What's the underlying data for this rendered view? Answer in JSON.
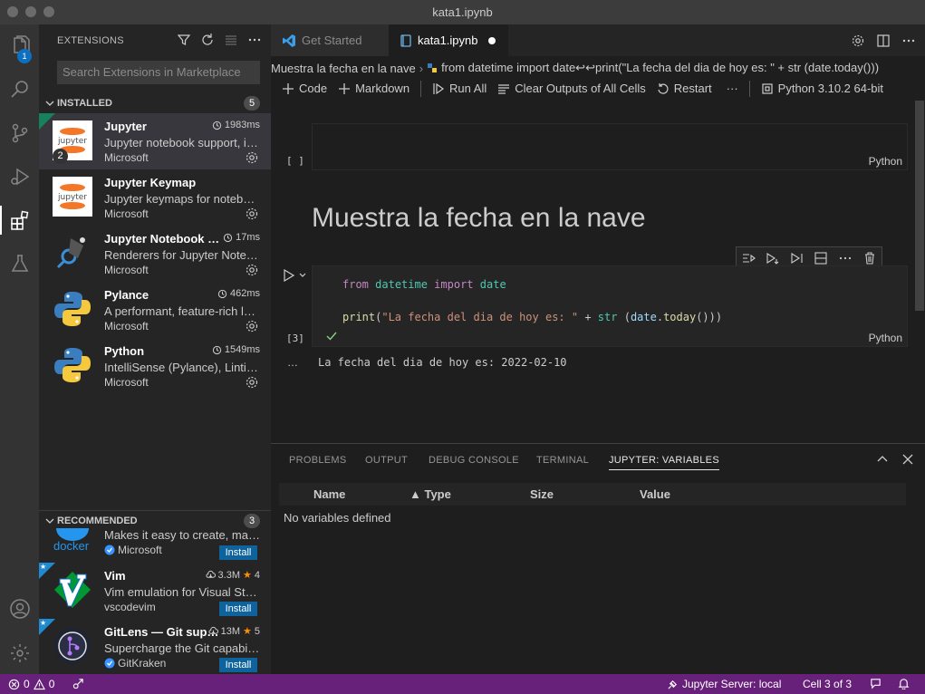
{
  "window": {
    "title": "kata1.ipynb"
  },
  "activity_bar": {
    "extensions_badge": "1"
  },
  "sidebar": {
    "title": "EXTENSIONS",
    "search_placeholder": "Search Extensions in Marketplace",
    "installed": {
      "label": "INSTALLED",
      "count": "5",
      "items": [
        {
          "name": "Jupyter",
          "stat": "1983ms",
          "desc": "Jupyter notebook support, interactive programming and computing",
          "publisher": "Microsoft",
          "badge": "2"
        },
        {
          "name": "Jupyter Keymap",
          "stat": "",
          "desc": "Jupyter keymaps for notebooks",
          "publisher": "Microsoft"
        },
        {
          "name": "Jupyter Notebook Renderers",
          "stat": "17ms",
          "desc": "Renderers for Jupyter Notebooks",
          "publisher": "Microsoft"
        },
        {
          "name": "Pylance",
          "stat": "462ms",
          "desc": "A performant, feature-rich language server",
          "publisher": "Microsoft"
        },
        {
          "name": "Python",
          "stat": "1549ms",
          "desc": "IntelliSense (Pylance), Linting, Debugging",
          "publisher": "Microsoft"
        }
      ]
    },
    "recommended": {
      "label": "RECOMMENDED",
      "count": "3",
      "items": [
        {
          "name": "Docker",
          "desc": "Makes it easy to create, manage, and debug",
          "publisher": "Microsoft",
          "logo_text": "docker",
          "install": "Install"
        },
        {
          "name": "Vim",
          "downloads": "3.3M",
          "rating": "4",
          "desc": "Vim emulation for Visual Studio Code",
          "publisher": "vscodevim",
          "install": "Install"
        },
        {
          "name": "GitLens — Git supercharged",
          "downloads": "13M",
          "rating": "5",
          "desc": "Supercharge the Git capabilities built into VS Code",
          "publisher": "GitKraken",
          "install": "Install"
        }
      ]
    }
  },
  "tabs": [
    {
      "label": "Get Started"
    },
    {
      "label": "kata1.ipynb"
    }
  ],
  "breadcrumb": {
    "part1": "Muestra la fecha en la nave",
    "part2": "from datetime import date↩↩print(\"La fecha del dia de hoy es: \" + str (date.today()))"
  },
  "notebook_toolbar": {
    "code": "Code",
    "markdown": "Markdown",
    "run_all": "Run All",
    "clear": "Clear Outputs of All Cells",
    "restart": "Restart",
    "more": "···",
    "kernel": "Python 3.10.2 64-bit"
  },
  "cells": {
    "empty_exec": "[ ]",
    "empty_lang": "Python",
    "markdown_heading": "Muestra la fecha en la nave",
    "code_exec": "[3]",
    "code_lang": "Python",
    "code": {
      "l1_from": "from",
      "l1_mod": "datetime",
      "l1_import": "import",
      "l1_name": "date",
      "l2_fn": "print",
      "l2_paren": "(",
      "l2_str": "\"La fecha del dia de hoy es: \"",
      "l2_plus": " + ",
      "l2_str_fn": "str",
      "l2_open": " (",
      "l2_var": "date",
      "l2_dot": ".",
      "l2_method": "today",
      "l2_close": "()))"
    },
    "output_ellipsis": "…",
    "output_text": "La fecha del dia de hoy es: 2022-02-10"
  },
  "panel": {
    "tabs": [
      "PROBLEMS",
      "OUTPUT",
      "DEBUG CONSOLE",
      "TERMINAL",
      "JUPYTER: VARIABLES"
    ],
    "columns": {
      "name": "Name",
      "type": "▲ Type",
      "size": "Size",
      "value": "Value"
    },
    "empty": "No variables defined"
  },
  "statusbar": {
    "errors": "0",
    "warnings": "0",
    "server": "Jupyter Server: local",
    "cell": "Cell 3 of 3"
  },
  "colors": {
    "statusbar": "#68217a",
    "install_button": "#0e639c",
    "accent_badge": "#0e70c0"
  }
}
